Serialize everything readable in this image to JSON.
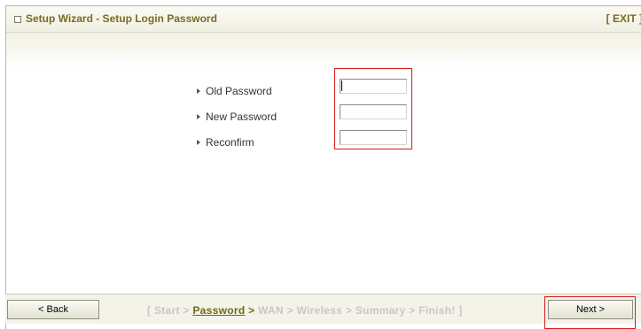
{
  "window": {
    "title": "Setup Wizard - Setup Login Password",
    "exit_label": "[ EXIT ]"
  },
  "form": {
    "fields": [
      {
        "label": "Old Password",
        "value": ""
      },
      {
        "label": "New Password",
        "value": ""
      },
      {
        "label": "Reconfirm",
        "value": ""
      }
    ]
  },
  "footer": {
    "back_label": "< Back",
    "next_label": "Next >",
    "steps": {
      "open_bracket": "[",
      "start": "Start",
      "sep": ">",
      "password": "Password",
      "wan": "WAN",
      "wireless": "Wireless",
      "summary": "Summary",
      "finish": "Finish!",
      "close_bracket": "]"
    }
  },
  "colors": {
    "title_text": "#7a6a22",
    "highlight": "#d81818",
    "active_step": "#6f6a10",
    "inactive_step": "#c8c8c0"
  }
}
